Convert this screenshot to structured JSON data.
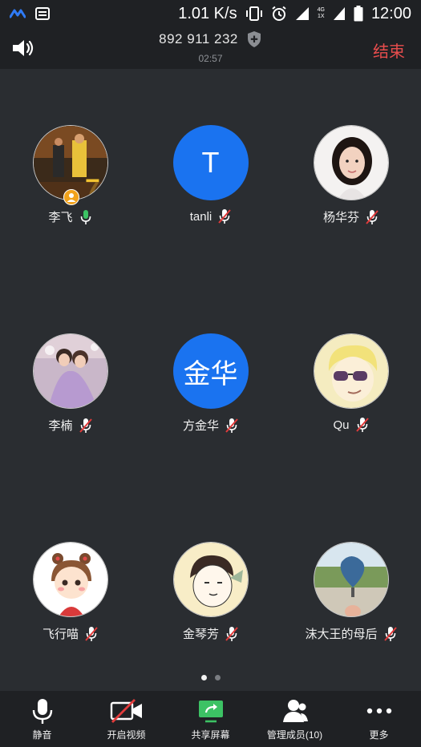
{
  "status_bar": {
    "speed": "1.01 K/s",
    "network_top": "4G",
    "network_bottom": "1X",
    "time": "12:00"
  },
  "header": {
    "meeting_id": "892 911 232",
    "timer": "02:57",
    "end_label": "结束"
  },
  "participants": [
    {
      "name": "李飞",
      "avatar_letter": "",
      "mic": "on",
      "host": true
    },
    {
      "name": "tanli",
      "avatar_letter": "T",
      "mic": "muted",
      "host": false
    },
    {
      "name": "杨华芬",
      "avatar_letter": "",
      "mic": "muted",
      "host": false
    },
    {
      "name": "李楠",
      "avatar_letter": "",
      "mic": "muted",
      "host": false
    },
    {
      "name": "方金华",
      "avatar_letter": "金华",
      "mic": "muted",
      "host": false
    },
    {
      "name": "Qu",
      "avatar_letter": "",
      "mic": "muted",
      "host": false
    },
    {
      "name": "飞行喵",
      "avatar_letter": "",
      "mic": "muted",
      "host": false
    },
    {
      "name": "金琴芳",
      "avatar_letter": "",
      "mic": "muted",
      "host": false
    },
    {
      "name": "沫大王的母后",
      "avatar_letter": "",
      "mic": "muted",
      "host": false
    }
  ],
  "page_indicator": {
    "current": 1,
    "total": 2
  },
  "toolbar": {
    "mute_label": "静音",
    "video_label": "开启视频",
    "share_label": "共享屏幕",
    "manage_label": "管理成员(10)",
    "more_label": "更多"
  },
  "colors": {
    "background": "#2a2d31",
    "bar": "#1f2124",
    "accent_blue": "#1a73f0",
    "end_red": "#e84d4d",
    "mic_green": "#3cc264",
    "muted_red": "#e23b3b"
  }
}
